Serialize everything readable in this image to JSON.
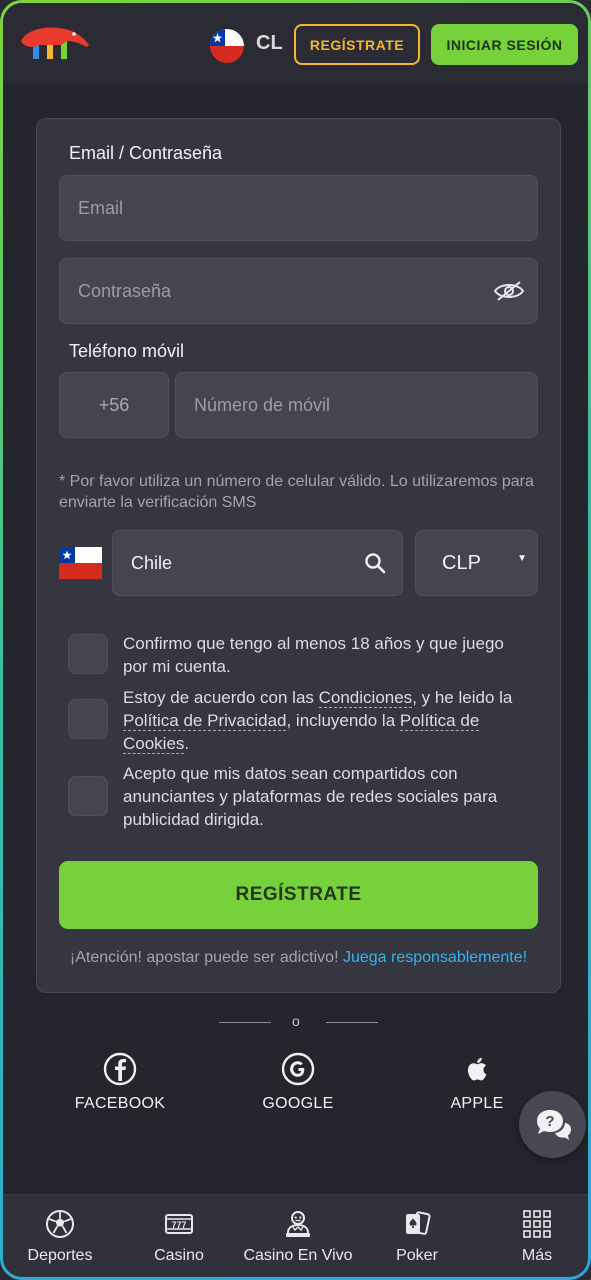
{
  "header": {
    "country_code": "CL",
    "register_label": "REGÍSTRATE",
    "login_label": "INICIAR SESIÓN"
  },
  "form": {
    "email_password_label": "Email / Contraseña",
    "email_placeholder": "Email",
    "password_placeholder": "Contraseña",
    "phone_label": "Teléfono móvil",
    "phone_prefix": "+56",
    "phone_placeholder": "Número de móvil",
    "phone_hint": "* Por favor utiliza un número de celular válido. Lo utilizaremos para enviarte la verificación SMS",
    "country_value": "Chile",
    "currency_value": "CLP",
    "checkbox_age": "Confirmo que tengo al menos 18 años y que juego por mi cuenta.",
    "checkbox_terms_1": "Estoy de acuerdo con las ",
    "checkbox_terms_link_conditions": "Condiciones",
    "checkbox_terms_2": ", y he leido la ",
    "checkbox_terms_link_privacy": "Política de Privacidad",
    "checkbox_terms_3": ", incluyendo la ",
    "checkbox_terms_link_cookies": "Política de Cookies",
    "checkbox_terms_4": ".",
    "checkbox_ads": "Acepto que mis datos sean compartidos con anunciantes y plataformas de redes sociales para publicidad dirigida.",
    "submit_label": "REGÍSTRATE",
    "warning_text": "¡Atención! apostar puede ser adictivo! ",
    "warning_link": "Juega responsablemente!"
  },
  "divider_text": "o",
  "social": {
    "facebook": "FACEBOOK",
    "google": "GOOGLE",
    "apple": "APPLE"
  },
  "bottom_nav": {
    "sports": "Deportes",
    "casino": "Casino",
    "live_casino": "Casino En Vivo",
    "poker": "Poker",
    "more": "Más"
  },
  "colors": {
    "accent_green": "#76d13a",
    "accent_yellow": "#f2b632",
    "link_blue": "#35b4f0"
  }
}
